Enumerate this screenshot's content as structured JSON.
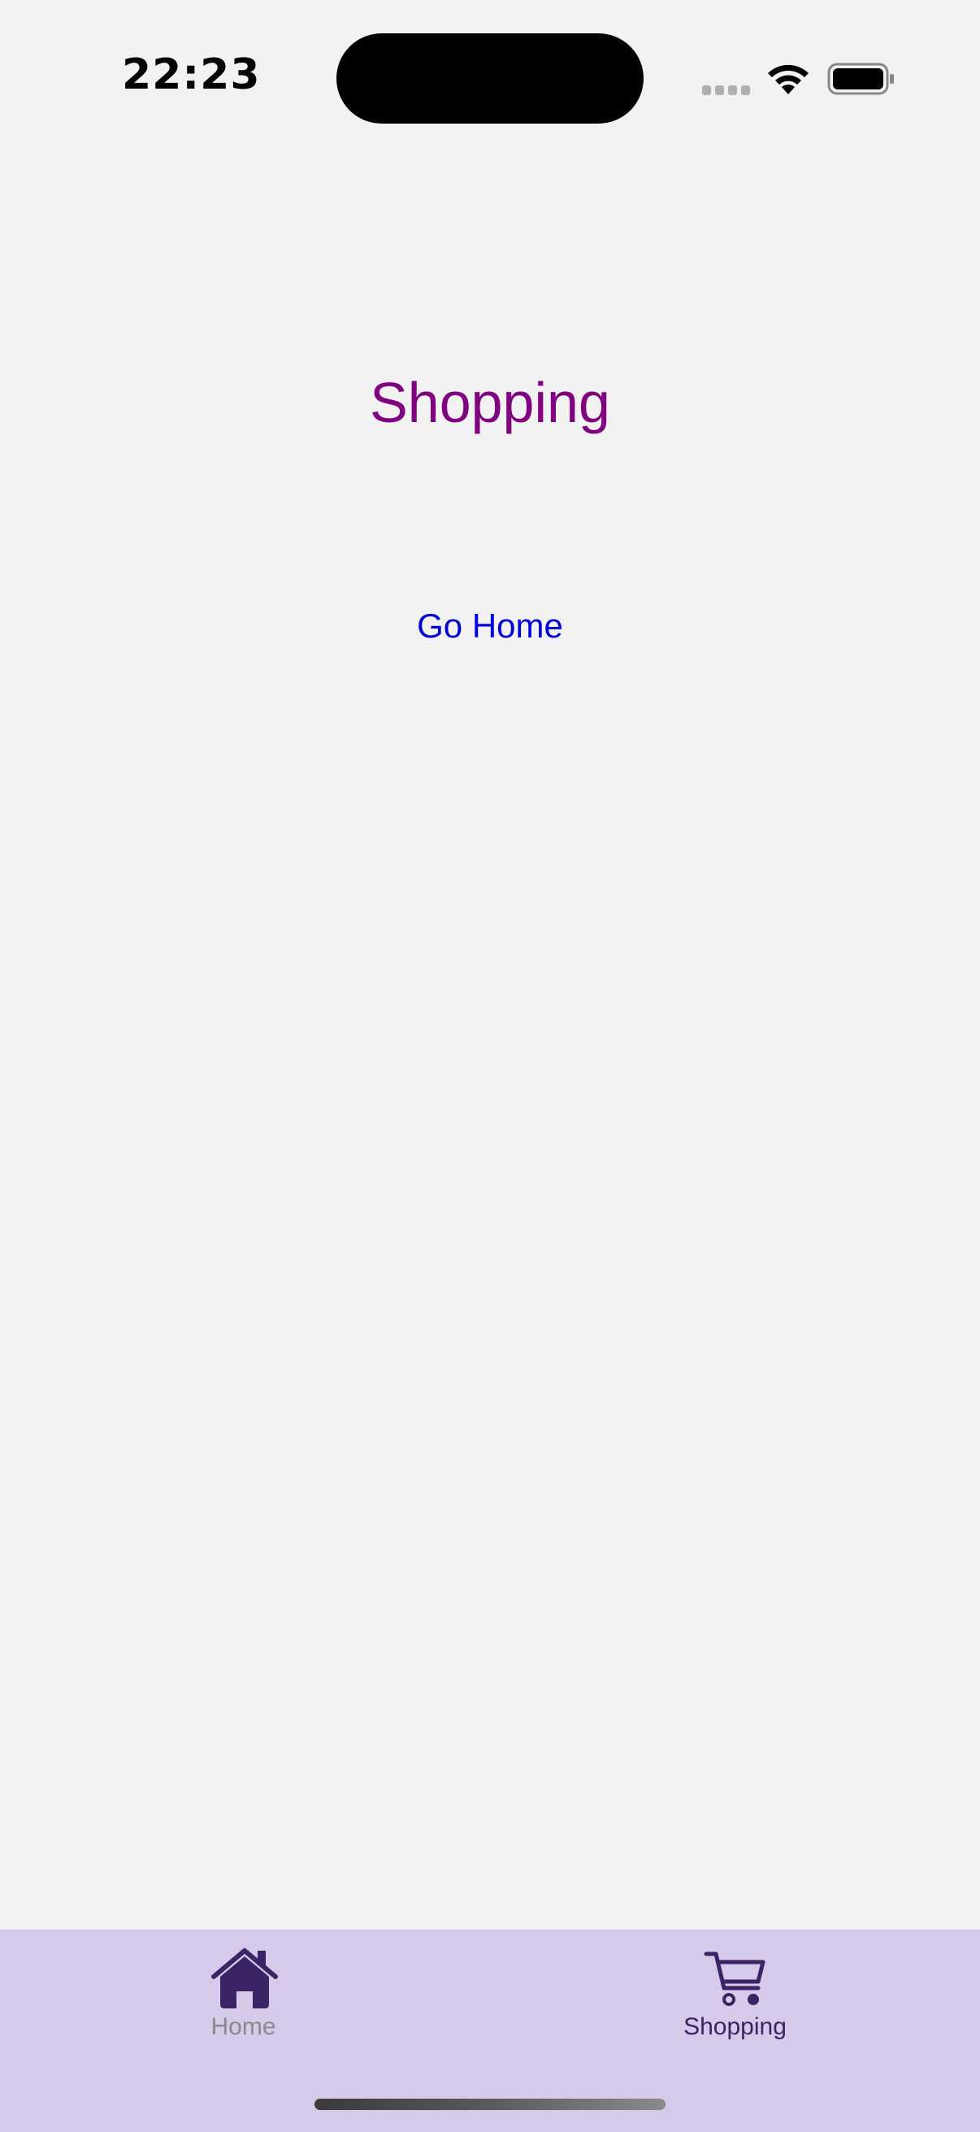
{
  "status_bar": {
    "time": "22:23"
  },
  "page": {
    "title": "Shopping",
    "go_home_label": "Go Home"
  },
  "tab_bar": {
    "items": [
      {
        "label": "Home",
        "icon": "home-icon",
        "selected": false
      },
      {
        "label": "Shopping",
        "icon": "cart-icon",
        "selected": true
      }
    ]
  },
  "colors": {
    "background": "#f2f2f2",
    "title": "#800080",
    "link": "#0000dd",
    "tab_bar_background": "#d6caea",
    "tab_active": "#3a2466",
    "tab_inactive": "#8a8a8a"
  }
}
